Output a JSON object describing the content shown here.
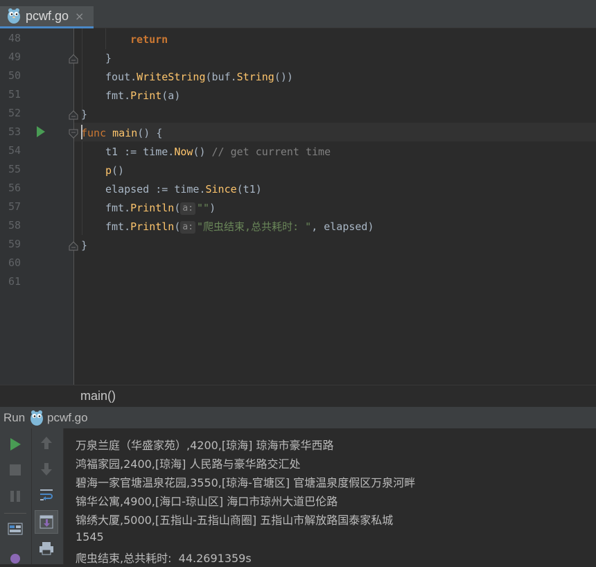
{
  "tab": {
    "filename": "pcwf.go",
    "close_symbol": "×"
  },
  "editor": {
    "line_numbers": [
      "48",
      "49",
      "50",
      "51",
      "52",
      "53",
      "54",
      "55",
      "56",
      "57",
      "58",
      "59",
      "60",
      "61"
    ],
    "hints": {
      "a": "a:"
    }
  },
  "code": {
    "l48_return": "return",
    "l49_brace": "}",
    "l50_fout": "fout.",
    "l50_writestring": "WriteString",
    "l50_paren_buf": "(buf.",
    "l50_string": "String",
    "l50_close": "())",
    "l51_fmt": "fmt.",
    "l51_print": "Print",
    "l51_args": "(a)",
    "l52_brace": "}",
    "l53_func": "func",
    "l53_main": "main",
    "l53_rest": "() {",
    "l54_assign": "t1 := time.",
    "l54_now": "Now",
    "l54_parens": "() ",
    "l54_comment": "// get current time",
    "l55_p": "p",
    "l55_parens": "()",
    "l56_assign": "elapsed := time.",
    "l56_since": "Since",
    "l56_args": "(t1)",
    "l57_fmt": "fmt.",
    "l57_println": "Println",
    "l57_open": "(",
    "l57_str": "\"\"",
    "l57_close": ")",
    "l58_fmt": "fmt.",
    "l58_println": "Println",
    "l58_open": "(",
    "l58_str": "\"爬虫结束,总共耗时: \"",
    "l58_rest": ", elapsed)",
    "l59_brace": "}"
  },
  "breadcrumb": {
    "label": "main()"
  },
  "run_panel": {
    "label": "Run",
    "config": "pcwf.go",
    "output": [
      "万泉兰庭（华盛家苑）,4200,[琼海] 琼海市豪华西路",
      "鸿福家园,2400,[琼海] 人民路与豪华路交汇处",
      "碧海一家官塘温泉花园,3550,[琼海-官塘区] 官塘温泉度假区万泉河畔",
      "锦华公寓,4900,[海口-琼山区] 海口市琼州大道巴伦路",
      "锦绣大厦,5000,[五指山-五指山商圈] 五指山市解放路国泰家私城",
      "1545",
      "爬虫结束,总共耗时:  44.2691359s"
    ]
  },
  "colors": {
    "background": "#2b2b2b",
    "keyword": "#cc7832",
    "function": "#ffc66d",
    "string": "#6a8759",
    "comment": "#808080",
    "run_green": "#499c54",
    "tab_underline": "#4a88c7"
  },
  "icons": {
    "file": "gopher-icon",
    "run": "play-icon",
    "stop": "stop-icon",
    "pause": "pause-icon",
    "up": "arrow-up-icon",
    "down": "arrow-down-icon",
    "soft_wrap": "soft-wrap-icon",
    "scroll_end": "scroll-to-end-icon",
    "layout": "layout-icon",
    "print": "print-icon"
  }
}
